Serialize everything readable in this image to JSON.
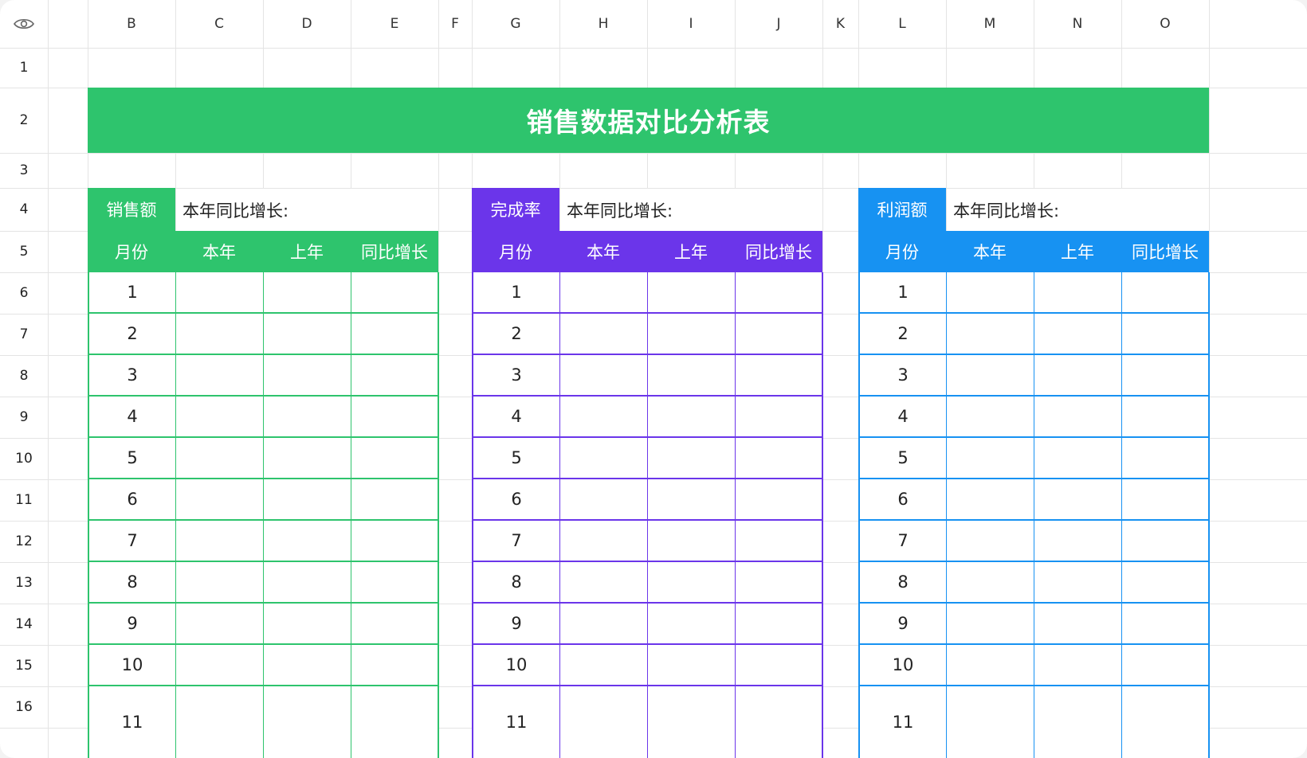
{
  "column_headers": [
    "B",
    "C",
    "D",
    "E",
    "F",
    "G",
    "H",
    "I",
    "J",
    "K",
    "L",
    "M",
    "N",
    "O"
  ],
  "row_headers": [
    "1",
    "2",
    "3",
    "4",
    "5",
    "6",
    "7",
    "8",
    "9",
    "10",
    "11",
    "12",
    "13",
    "14",
    "15",
    "16"
  ],
  "title": "销售数据对比分析表",
  "yoy_label": "本年同比增长:",
  "table_headers": [
    "月份",
    "本年",
    "上年",
    "同比增长"
  ],
  "months": [
    "1",
    "2",
    "3",
    "4",
    "5",
    "6",
    "7",
    "8",
    "9",
    "10",
    "11"
  ],
  "sections": [
    {
      "tag": "销售额",
      "color": "#2ec46d"
    },
    {
      "tag": "完成率",
      "color": "#6b35ea"
    },
    {
      "tag": "利润额",
      "color": "#1792f2"
    }
  ],
  "grid_color": "#e4e4e4",
  "header_icon": "eye-icon"
}
